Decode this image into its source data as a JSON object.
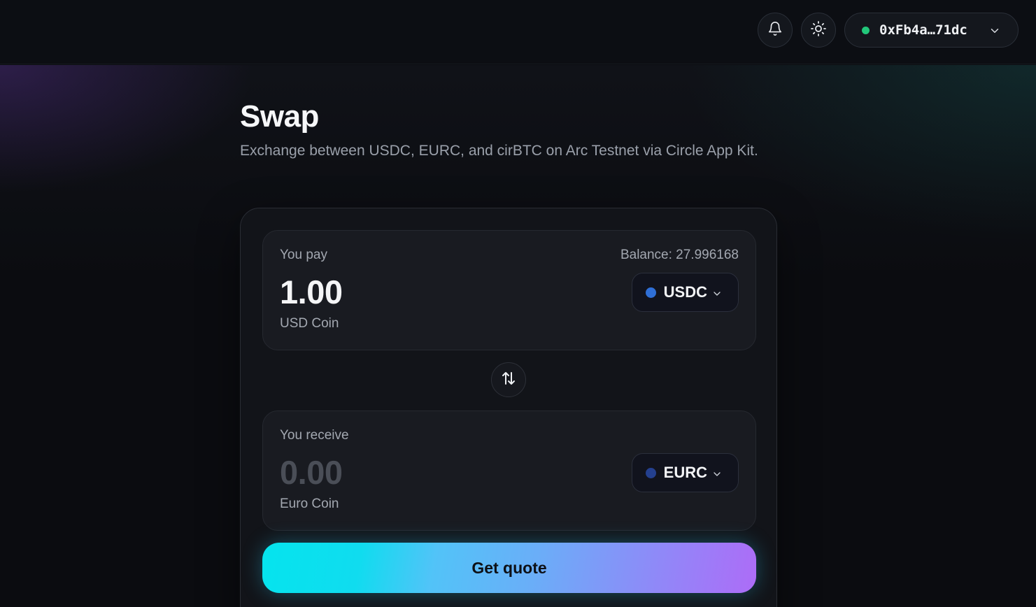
{
  "header": {
    "wallet_address": "0xFb4a…71dc",
    "wallet_status_color": "#22c77a",
    "icons": [
      "bell-icon",
      "sun-icon",
      "chevron-down-icon"
    ]
  },
  "page": {
    "title": "Swap",
    "subtitle": "Exchange between USDC, EURC, and cirBTC on Arc Testnet via Circle App Kit."
  },
  "swap": {
    "pay": {
      "label": "You pay",
      "balance": "Balance: 27.996168",
      "amount": "1.00",
      "coin_name": "USD Coin",
      "token": "USDC",
      "token_color": "#2f6fd6"
    },
    "receive": {
      "label": "You receive",
      "amount": "0.00",
      "coin_name": "Euro Coin",
      "token": "EURC",
      "token_color": "#24408f"
    },
    "quote_button": "Get quote"
  }
}
